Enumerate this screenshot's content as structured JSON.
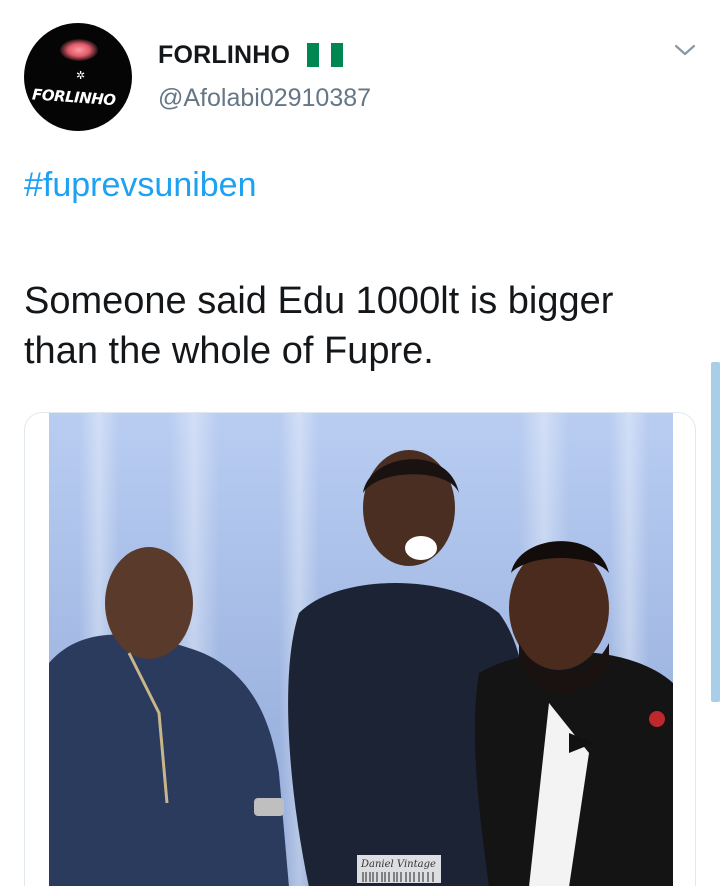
{
  "user": {
    "display_name": "FORLINHO",
    "handle": "@Afolabi02910387",
    "avatar_text": "FORLINHO",
    "verified_flag_colors": [
      "#008751",
      "#ffffff",
      "#008751"
    ]
  },
  "tweet": {
    "hashtag": "#fuprevsuniben",
    "text": "Someone said Edu 1000lt is bigger than the whole of Fupre."
  },
  "media": {
    "watermark": "Daniel Vintage"
  },
  "colors": {
    "link": "#1da1f2",
    "handle": "#657786",
    "text": "#14171a"
  }
}
